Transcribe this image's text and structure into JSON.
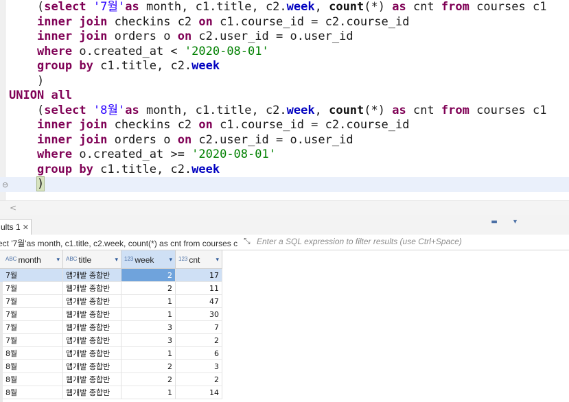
{
  "editor": {
    "lines": [
      [
        {
          "t": "    "
        },
        {
          "t": "(",
          "c": "paren-plain"
        },
        {
          "t": "select",
          "c": "kw"
        },
        {
          "t": " "
        },
        {
          "t": "'7월'",
          "c": "str"
        },
        {
          "t": "as",
          "c": "kw"
        },
        {
          "t": " month, c1.title, c2."
        },
        {
          "t": "week",
          "c": "col"
        },
        {
          "t": ", "
        },
        {
          "t": "count",
          "c": "fn"
        },
        {
          "t": "(*) "
        },
        {
          "t": "as",
          "c": "kw"
        },
        {
          "t": " cnt "
        },
        {
          "t": "from",
          "c": "kw"
        },
        {
          "t": " courses c1"
        }
      ],
      [
        {
          "t": "    "
        },
        {
          "t": "inner",
          "c": "kw"
        },
        {
          "t": " "
        },
        {
          "t": "join",
          "c": "kw"
        },
        {
          "t": " checkins c2 "
        },
        {
          "t": "on",
          "c": "kw"
        },
        {
          "t": " c1.course_id = c2.course_id"
        }
      ],
      [
        {
          "t": "    "
        },
        {
          "t": "inner",
          "c": "kw"
        },
        {
          "t": " "
        },
        {
          "t": "join",
          "c": "kw"
        },
        {
          "t": " orders o "
        },
        {
          "t": "on",
          "c": "kw"
        },
        {
          "t": " c2.user_id = o.user_id"
        }
      ],
      [
        {
          "t": "    "
        },
        {
          "t": "where",
          "c": "kw"
        },
        {
          "t": " o.created_at < "
        },
        {
          "t": "'2020-08-01'",
          "c": "strg"
        }
      ],
      [
        {
          "t": "    "
        },
        {
          "t": "group",
          "c": "kw"
        },
        {
          "t": " "
        },
        {
          "t": "by",
          "c": "kw"
        },
        {
          "t": " c1.title, c2."
        },
        {
          "t": "week",
          "c": "col"
        }
      ],
      [
        {
          "t": "    )"
        }
      ],
      [
        {
          "t": "UNION",
          "c": "kw"
        },
        {
          "t": " "
        },
        {
          "t": "all",
          "c": "kw"
        }
      ],
      [
        {
          "t": "    "
        },
        {
          "t": "(",
          "c": "paren-plain"
        },
        {
          "t": "select",
          "c": "kw"
        },
        {
          "t": " "
        },
        {
          "t": "'8월'",
          "c": "str"
        },
        {
          "t": "as",
          "c": "kw"
        },
        {
          "t": " month, c1.title, c2."
        },
        {
          "t": "week",
          "c": "col"
        },
        {
          "t": ", "
        },
        {
          "t": "count",
          "c": "fn"
        },
        {
          "t": "(*) "
        },
        {
          "t": "as",
          "c": "kw"
        },
        {
          "t": " cnt "
        },
        {
          "t": "from",
          "c": "kw"
        },
        {
          "t": " courses c1"
        }
      ],
      [
        {
          "t": "    "
        },
        {
          "t": "inner",
          "c": "kw"
        },
        {
          "t": " "
        },
        {
          "t": "join",
          "c": "kw"
        },
        {
          "t": " checkins c2 "
        },
        {
          "t": "on",
          "c": "kw"
        },
        {
          "t": " c1.course_id = c2.course_id"
        }
      ],
      [
        {
          "t": "    "
        },
        {
          "t": "inner",
          "c": "kw"
        },
        {
          "t": " "
        },
        {
          "t": "join",
          "c": "kw"
        },
        {
          "t": " orders o "
        },
        {
          "t": "on",
          "c": "kw"
        },
        {
          "t": " c2.user_id = o.user_id"
        }
      ],
      [
        {
          "t": "    "
        },
        {
          "t": "where",
          "c": "kw"
        },
        {
          "t": " o.created_at >= "
        },
        {
          "t": "'2020-08-01'",
          "c": "strg"
        }
      ],
      [
        {
          "t": "    "
        },
        {
          "t": "group",
          "c": "kw"
        },
        {
          "t": " "
        },
        {
          "t": "by",
          "c": "kw"
        },
        {
          "t": " c1.title, c2."
        },
        {
          "t": "week",
          "c": "col"
        }
      ],
      [
        {
          "t": "    "
        },
        {
          "t": ")",
          "c": "paren"
        }
      ]
    ],
    "current_line": 12,
    "fold_marker": "⊖",
    "scroll_left_glyph": "<"
  },
  "results": {
    "tab_label": "ults 1",
    "tab_close": "✕",
    "panel_controls": "▬ ▾",
    "query_label": "ect '7월'as month, c1.title, c2.week, count(*) as cnt from courses c",
    "expand_icon": "⤡",
    "filter_placeholder": "Enter a SQL expression to filter results (use Ctrl+Space)",
    "columns": [
      {
        "label": "month",
        "type_icon": "ABC",
        "sort": "▾"
      },
      {
        "label": "title",
        "type_icon": "ABC",
        "sort": "▾"
      },
      {
        "label": "week",
        "type_icon": "123",
        "sort": "▾"
      },
      {
        "label": "cnt",
        "type_icon": "123",
        "sort": "▾"
      }
    ],
    "rows": [
      [
        "7월",
        "앱개발 종합반",
        "2",
        "17"
      ],
      [
        "7월",
        "웹개발 종합반",
        "2",
        "11"
      ],
      [
        "7월",
        "앱개발 종합반",
        "1",
        "47"
      ],
      [
        "7월",
        "웹개발 종합반",
        "1",
        "30"
      ],
      [
        "7월",
        "웹개발 종합반",
        "3",
        "7"
      ],
      [
        "7월",
        "앱개발 종합반",
        "3",
        "2"
      ],
      [
        "8월",
        "앱개발 종합반",
        "1",
        "6"
      ],
      [
        "8월",
        "앱개발 종합반",
        "2",
        "3"
      ],
      [
        "8월",
        "웹개발 종합반",
        "2",
        "2"
      ],
      [
        "8월",
        "웹개발 종합반",
        "1",
        "14"
      ]
    ]
  }
}
